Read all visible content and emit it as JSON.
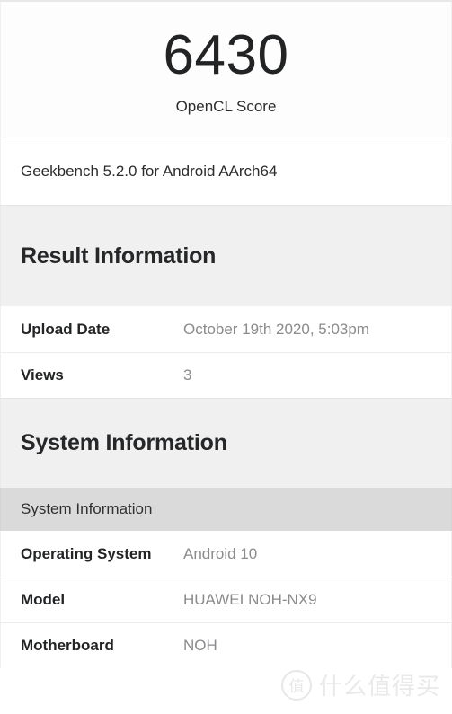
{
  "hero": {
    "score": "6430",
    "score_label": "OpenCL Score"
  },
  "version": {
    "text": "Geekbench 5.2.0 for Android AArch64"
  },
  "result_information": {
    "heading": "Result Information",
    "rows": [
      {
        "label": "Upload Date",
        "value": "October 19th 2020, 5:03pm"
      },
      {
        "label": "Views",
        "value": "3"
      }
    ]
  },
  "system_information": {
    "heading": "System Information",
    "subheader": "System Information",
    "rows": [
      {
        "label": "Operating System",
        "value": "Android 10"
      },
      {
        "label": "Model",
        "value": "HUAWEI NOH-NX9"
      },
      {
        "label": "Motherboard",
        "value": "NOH"
      }
    ]
  },
  "watermark": {
    "badge": "值",
    "text": "什么值得买"
  },
  "colors": {
    "section_band": "#f0f0f0",
    "subheader_band": "#dadada",
    "label_text": "#232426",
    "value_text": "#8a8b8d",
    "score_text": "#222325"
  }
}
